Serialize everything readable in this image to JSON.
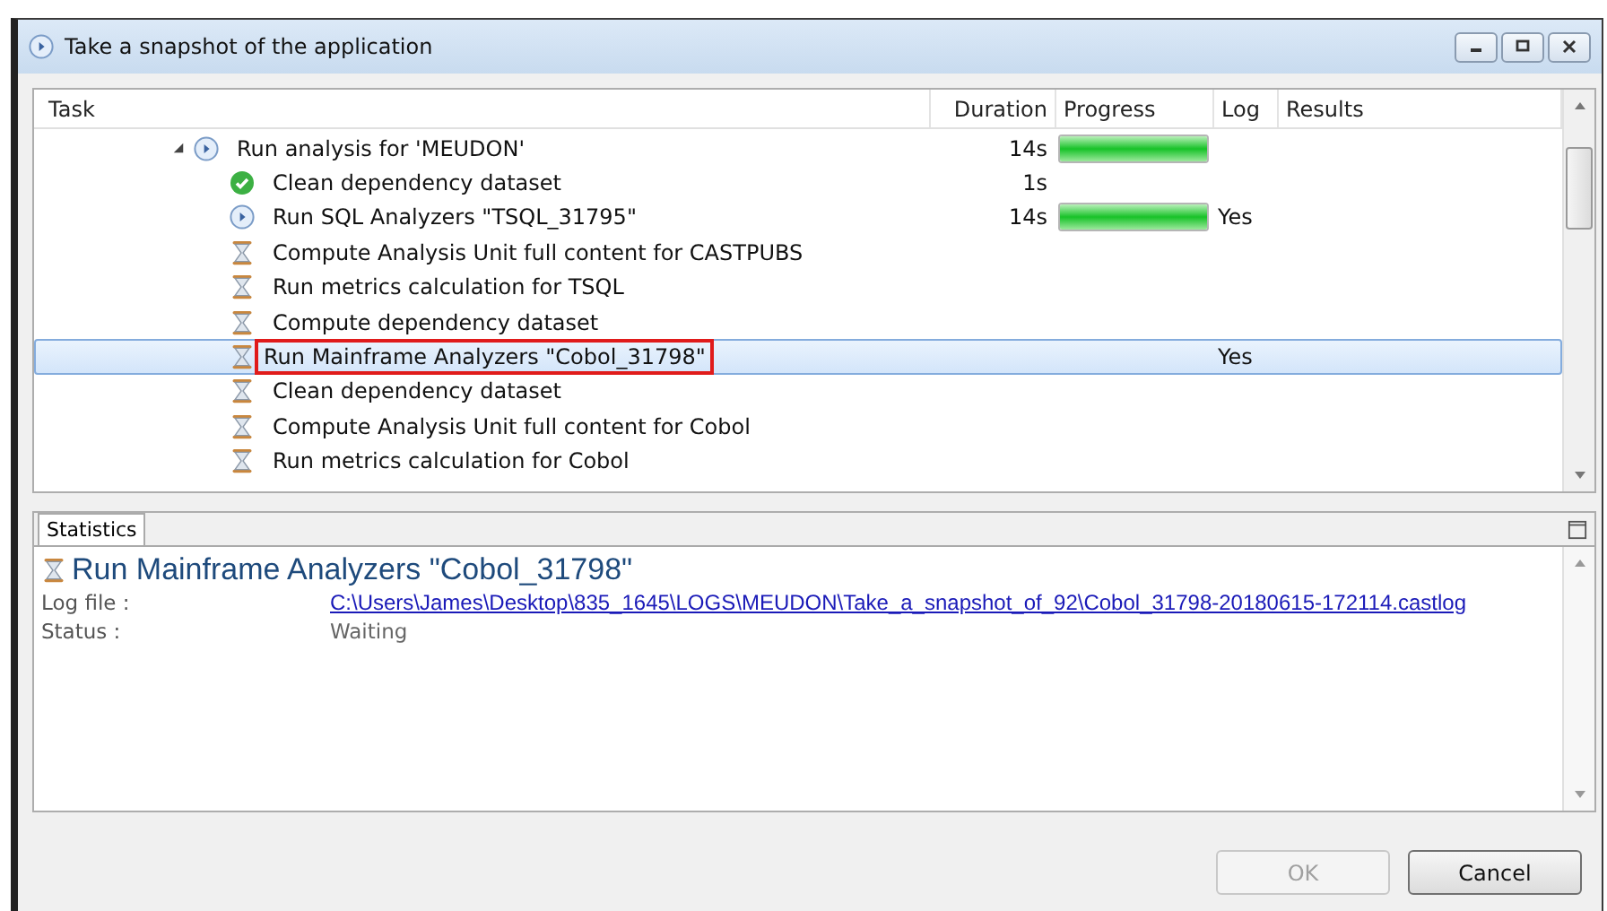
{
  "window": {
    "title": "Take a snapshot of the application"
  },
  "table": {
    "columns": [
      "Task",
      "Duration",
      "Progress",
      "Log",
      "Results"
    ],
    "rows": [
      {
        "label": "Run analysis for 'MEUDON'",
        "kind": "running",
        "expanded": true,
        "selected": false,
        "highlighted": false,
        "duration": "14s",
        "level": 1,
        "children": [
          {
            "label": "Clean dependency dataset",
            "kind": "done",
            "selected": false,
            "highlighted": false,
            "duration": "1s"
          },
          {
            "label": "Run SQL Analyzers \"TSQL_31795\"",
            "kind": "running",
            "selected": false,
            "highlighted": false,
            "duration": "14s",
            "level": 1,
            "log": "Yes"
          },
          {
            "label": "Compute Analysis Unit full content for CASTPUBS",
            "kind": "waiting",
            "selected": false,
            "highlighted": false
          },
          {
            "label": "Run metrics calculation for TSQL",
            "kind": "waiting",
            "selected": false,
            "highlighted": false
          },
          {
            "label": "Compute dependency dataset",
            "kind": "waiting",
            "selected": false,
            "highlighted": false
          },
          {
            "label": "Run Mainframe Analyzers \"Cobol_31798\"",
            "kind": "waiting",
            "selected": true,
            "highlighted": true,
            "log": "Yes"
          },
          {
            "label": "Clean dependency dataset",
            "kind": "waiting",
            "selected": false,
            "highlighted": false
          },
          {
            "label": "Compute Analysis Unit full content for Cobol",
            "kind": "waiting",
            "selected": false,
            "highlighted": false
          },
          {
            "label": "Run metrics calculation for Cobol",
            "kind": "waiting",
            "selected": false,
            "highlighted": false
          }
        ]
      }
    ]
  },
  "statistics": {
    "tab": "Statistics",
    "title": "Run Mainframe Analyzers \"Cobol_31798\"",
    "kind": "waiting",
    "fields": [
      {
        "label": "Log file :",
        "value": "C:\\Users\\James\\Desktop\\835_1645\\LOGS\\MEUDON\\Take_a_snapshot_of_92\\Cobol_31798-20180615-172114.castlog",
        "kind": "link"
      },
      {
        "label": "Status :",
        "value": "Waiting",
        "kind": "text"
      }
    ]
  },
  "buttons": [
    {
      "label": "OK",
      "disabled": true
    },
    {
      "label": "Cancel",
      "disabled": false
    }
  ]
}
